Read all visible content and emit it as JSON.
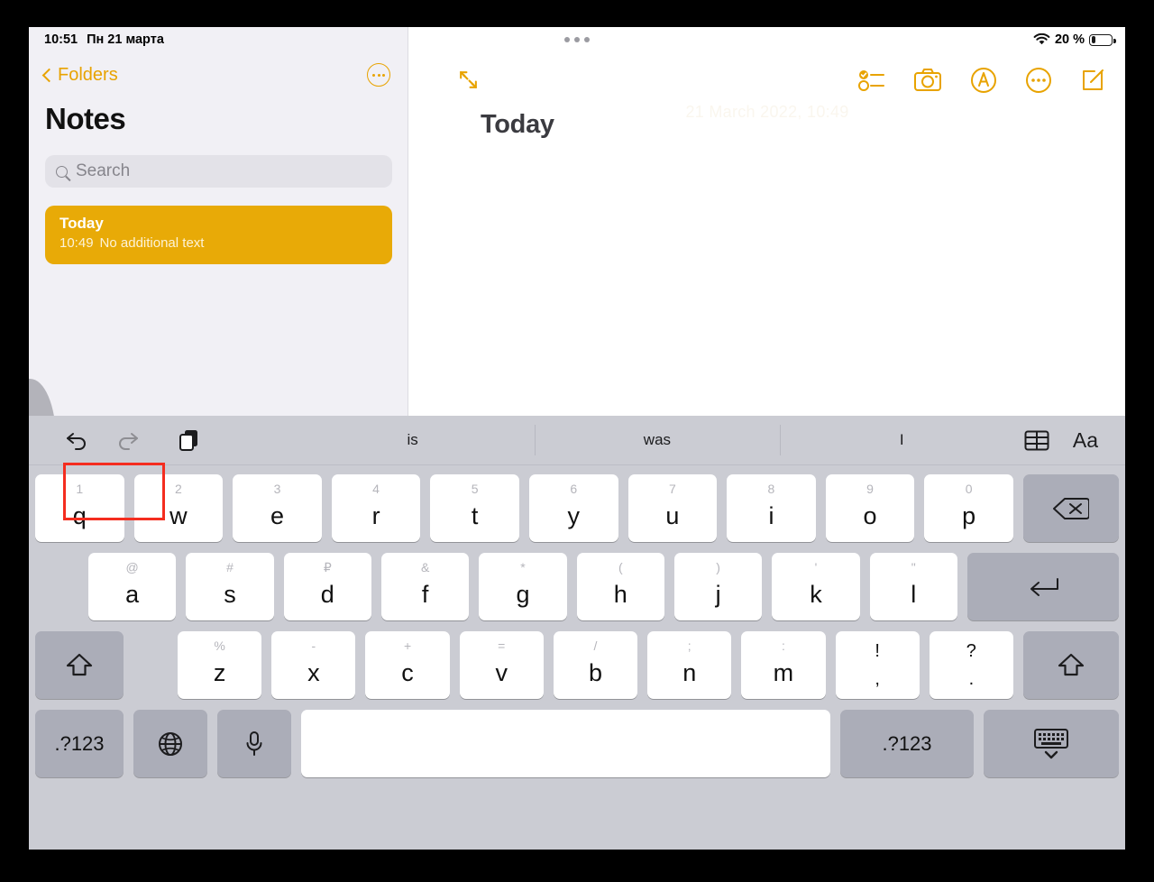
{
  "status_bar": {
    "time": "10:51",
    "date": "Пн 21 марта",
    "battery_percent": "20 %",
    "wifi_icon": "wifi-icon",
    "battery_icon": "battery-low-icon",
    "multitask_handle": "multitasking-handle"
  },
  "sidebar": {
    "back_label": "Folders",
    "title": "Notes",
    "search_placeholder": "Search",
    "more_icon": "circle-ellipsis-icon",
    "notes": [
      {
        "title": "Today",
        "time": "10:49",
        "preview": "No additional text",
        "selected": true
      }
    ]
  },
  "detail": {
    "title": "Today",
    "date_stamp": "21 March 2022, 10:49",
    "expand_icon": "expand-arrows-icon",
    "toolbar_icons": [
      "checklist-icon",
      "camera-icon",
      "markup-pen-icon",
      "ellipsis-circle-icon",
      "compose-icon"
    ]
  },
  "keyboard": {
    "toolbar": {
      "undo_icon": "undo-arrow-icon",
      "redo_icon": "redo-arrow-icon",
      "paste_icon": "paste-clipboard-icon",
      "table_icon": "table-grid-icon",
      "format_label": "Aa"
    },
    "suggestions": [
      "is",
      "was",
      "I"
    ],
    "row1": [
      {
        "main": "q",
        "alt": "1"
      },
      {
        "main": "w",
        "alt": "2"
      },
      {
        "main": "e",
        "alt": "3"
      },
      {
        "main": "r",
        "alt": "4"
      },
      {
        "main": "t",
        "alt": "5"
      },
      {
        "main": "y",
        "alt": "6"
      },
      {
        "main": "u",
        "alt": "7"
      },
      {
        "main": "i",
        "alt": "8"
      },
      {
        "main": "o",
        "alt": "9"
      },
      {
        "main": "p",
        "alt": "0"
      }
    ],
    "row2": [
      {
        "main": "a",
        "alt": "@"
      },
      {
        "main": "s",
        "alt": "#"
      },
      {
        "main": "d",
        "alt": "₽"
      },
      {
        "main": "f",
        "alt": "&"
      },
      {
        "main": "g",
        "alt": "*"
      },
      {
        "main": "h",
        "alt": "("
      },
      {
        "main": "j",
        "alt": ")"
      },
      {
        "main": "k",
        "alt": "'"
      },
      {
        "main": "l",
        "alt": "\""
      }
    ],
    "row3": [
      {
        "main": "z",
        "alt": "%"
      },
      {
        "main": "x",
        "alt": "-"
      },
      {
        "main": "c",
        "alt": "+"
      },
      {
        "main": "v",
        "alt": "="
      },
      {
        "main": "b",
        "alt": "/"
      },
      {
        "main": "n",
        "alt": ";"
      },
      {
        "main": "m",
        "alt": ":"
      },
      {
        "main": ",",
        "alt": "!"
      },
      {
        "main": ".",
        "alt": "?"
      }
    ],
    "delete_icon": "backspace-delete-icon",
    "return_icon": "return-arrow-icon",
    "shift_icon": "shift-arrow-icon",
    "numbers_label": ".?123",
    "globe_icon": "globe-language-icon",
    "mic_icon": "microphone-icon",
    "dismiss_icon": "dismiss-keyboard-icon"
  },
  "annotation": {
    "highlight_color": "#f42d1f",
    "highlight_target": "undo-redo-group"
  },
  "colors": {
    "accent": "#e8a300",
    "note_selected": "#e8aa07",
    "keyboard_bg": "#cbccd3",
    "sidebar_bg": "#f1f0f5"
  }
}
